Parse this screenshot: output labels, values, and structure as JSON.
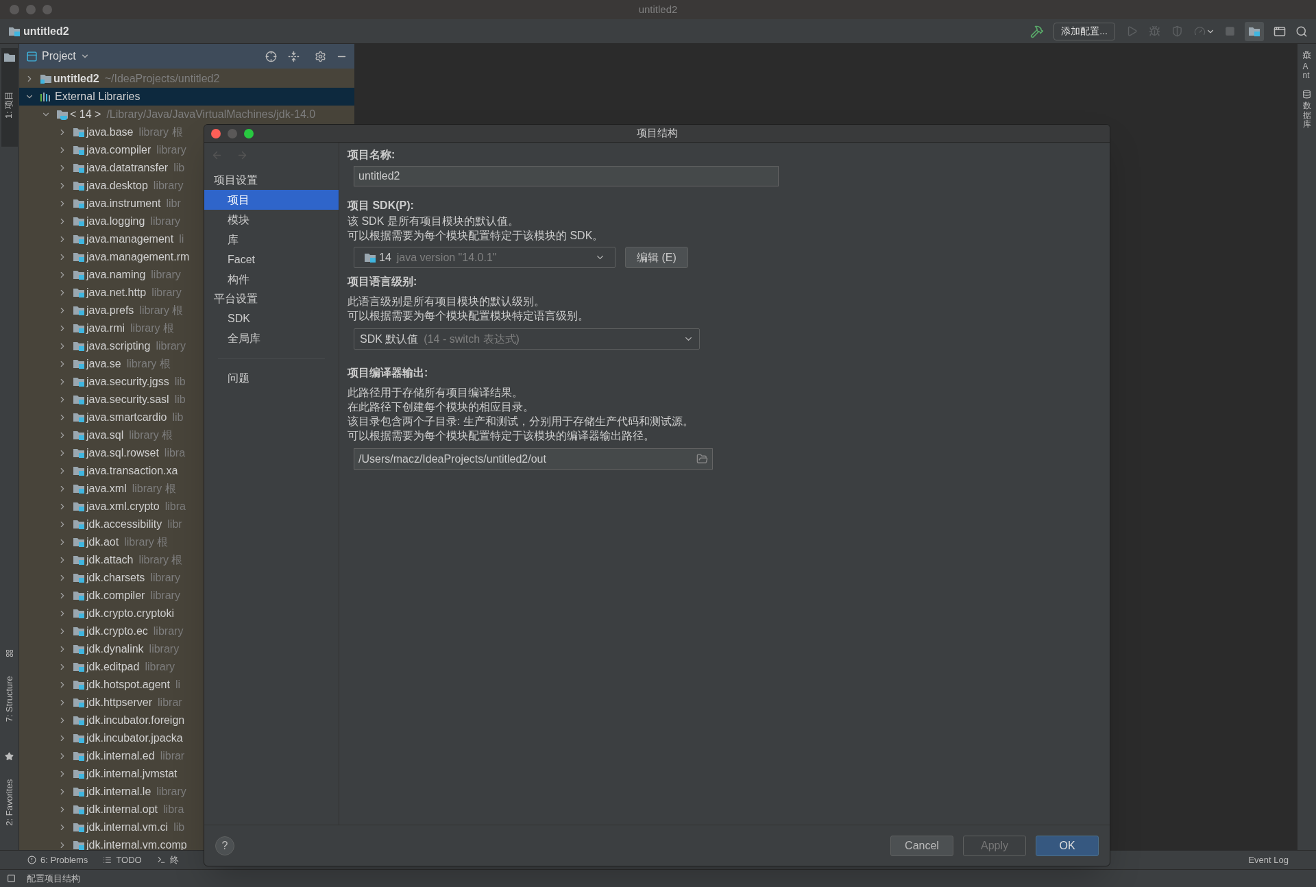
{
  "window": {
    "title": "untitled2"
  },
  "navbar": {
    "project": "untitled2",
    "run_config": "添加配置..."
  },
  "left_strip": [
    {
      "label": "1: 项目",
      "selected": true,
      "kind": "project"
    },
    {
      "label": "7: Structure",
      "selected": false,
      "kind": "structure"
    },
    {
      "label": "2: Favorites",
      "selected": false,
      "kind": "favorites"
    }
  ],
  "right_strip": [
    {
      "label": "Ant",
      "kind": "ant"
    },
    {
      "label": "数据库",
      "kind": "database"
    }
  ],
  "project_panel": {
    "title": "Project",
    "tree": [
      {
        "name": "untitled2",
        "hint": "~/IdeaProjects/untitled2",
        "kind": "module",
        "expanded": false,
        "selected": false
      },
      {
        "name": "External Libraries",
        "kind": "libraries",
        "expanded": true,
        "selected": true,
        "children": [
          {
            "name": "< 14 >",
            "hint": "/Library/Java/JavaVirtualMachines/jdk-14.0",
            "kind": "sdk",
            "expanded": true,
            "selected": false,
            "children": [
              {
                "name": "java.base",
                "hint": "library 根",
                "kind": "package",
                "expanded": false,
                "selected": false
              },
              {
                "name": "java.compiler",
                "hint": "library",
                "kind": "package",
                "expanded": false,
                "selected": false
              },
              {
                "name": "java.datatransfer",
                "hint": "lib",
                "kind": "package",
                "expanded": false,
                "selected": false
              },
              {
                "name": "java.desktop",
                "hint": "library",
                "kind": "package",
                "expanded": false,
                "selected": false
              },
              {
                "name": "java.instrument",
                "hint": "libr",
                "kind": "package",
                "expanded": false,
                "selected": false
              },
              {
                "name": "java.logging",
                "hint": "library",
                "kind": "package",
                "expanded": false,
                "selected": false
              },
              {
                "name": "java.management",
                "hint": "li",
                "kind": "package",
                "expanded": false,
                "selected": false
              },
              {
                "name": "java.management.rm",
                "kind": "package",
                "expanded": false,
                "selected": false
              },
              {
                "name": "java.naming",
                "hint": "library",
                "kind": "package",
                "expanded": false,
                "selected": false
              },
              {
                "name": "java.net.http",
                "hint": "library",
                "kind": "package",
                "expanded": false,
                "selected": false
              },
              {
                "name": "java.prefs",
                "hint": "library 根",
                "kind": "package",
                "expanded": false,
                "selected": false
              },
              {
                "name": "java.rmi",
                "hint": "library 根",
                "kind": "package",
                "expanded": false,
                "selected": false
              },
              {
                "name": "java.scripting",
                "hint": "library",
                "kind": "package",
                "expanded": false,
                "selected": false
              },
              {
                "name": "java.se",
                "hint": "library 根",
                "kind": "package",
                "expanded": false,
                "selected": false
              },
              {
                "name": "java.security.jgss",
                "hint": "lib",
                "kind": "package",
                "expanded": false,
                "selected": false
              },
              {
                "name": "java.security.sasl",
                "hint": "lib",
                "kind": "package",
                "expanded": false,
                "selected": false
              },
              {
                "name": "java.smartcardio",
                "hint": "lib",
                "kind": "package",
                "expanded": false,
                "selected": false
              },
              {
                "name": "java.sql",
                "hint": "library 根",
                "kind": "package",
                "expanded": false,
                "selected": false
              },
              {
                "name": "java.sql.rowset",
                "hint": "libra",
                "kind": "package",
                "expanded": false,
                "selected": false
              },
              {
                "name": "java.transaction.xa",
                "kind": "package",
                "expanded": false,
                "selected": false
              },
              {
                "name": "java.xml",
                "hint": "library 根",
                "kind": "package",
                "expanded": false,
                "selected": false
              },
              {
                "name": "java.xml.crypto",
                "hint": "libra",
                "kind": "package",
                "expanded": false,
                "selected": false
              },
              {
                "name": "jdk.accessibility",
                "hint": "libr",
                "kind": "package",
                "expanded": false,
                "selected": false
              },
              {
                "name": "jdk.aot",
                "hint": "library 根",
                "kind": "package",
                "expanded": false,
                "selected": false
              },
              {
                "name": "jdk.attach",
                "hint": "library 根",
                "kind": "package",
                "expanded": false,
                "selected": false
              },
              {
                "name": "jdk.charsets",
                "hint": "library",
                "kind": "package",
                "expanded": false,
                "selected": false
              },
              {
                "name": "jdk.compiler",
                "hint": "library",
                "kind": "package",
                "expanded": false,
                "selected": false
              },
              {
                "name": "jdk.crypto.cryptoki",
                "kind": "package",
                "expanded": false,
                "selected": false
              },
              {
                "name": "jdk.crypto.ec",
                "hint": "library",
                "kind": "package",
                "expanded": false,
                "selected": false
              },
              {
                "name": "jdk.dynalink",
                "hint": "library",
                "kind": "package",
                "expanded": false,
                "selected": false
              },
              {
                "name": "jdk.editpad",
                "hint": "library",
                "kind": "package",
                "expanded": false,
                "selected": false
              },
              {
                "name": "jdk.hotspot.agent",
                "hint": "li",
                "kind": "package",
                "expanded": false,
                "selected": false
              },
              {
                "name": "jdk.httpserver",
                "hint": "librar",
                "kind": "package",
                "expanded": false,
                "selected": false
              },
              {
                "name": "jdk.incubator.foreign",
                "kind": "package",
                "expanded": false,
                "selected": false
              },
              {
                "name": "jdk.incubator.jpacka",
                "kind": "package",
                "expanded": false,
                "selected": false
              },
              {
                "name": "jdk.internal.ed",
                "hint": "librar",
                "kind": "package",
                "expanded": false,
                "selected": false
              },
              {
                "name": "jdk.internal.jvmstat",
                "kind": "package",
                "expanded": false,
                "selected": false
              },
              {
                "name": "jdk.internal.le",
                "hint": "library",
                "kind": "package",
                "expanded": false,
                "selected": false
              },
              {
                "name": "jdk.internal.opt",
                "hint": "libra",
                "kind": "package",
                "expanded": false,
                "selected": false
              },
              {
                "name": "jdk.internal.vm.ci",
                "hint": "lib",
                "kind": "package",
                "expanded": false,
                "selected": false
              },
              {
                "name": "jdk.internal.vm.comp",
                "kind": "package",
                "expanded": false,
                "selected": false
              }
            ]
          }
        ]
      }
    ]
  },
  "bottom_tools": [
    {
      "label": "6: Problems",
      "kind": "problems"
    },
    {
      "label": "TODO",
      "kind": "todo"
    },
    {
      "label": "终",
      "kind": "terminal"
    }
  ],
  "event_log": "Event Log",
  "status": "配置项目结构",
  "dialog": {
    "title": "项目结构",
    "nav": [
      {
        "label": "项目设置",
        "kind": "header"
      },
      {
        "label": "项目",
        "kind": "item",
        "selected": true
      },
      {
        "label": "模块",
        "kind": "item",
        "selected": false
      },
      {
        "label": "库",
        "kind": "item",
        "selected": false
      },
      {
        "label": "Facet",
        "kind": "item",
        "selected": false
      },
      {
        "label": "构件",
        "kind": "item",
        "selected": false
      },
      {
        "label": "平台设置",
        "kind": "header"
      },
      {
        "label": "SDK",
        "kind": "item",
        "selected": false
      },
      {
        "label": "全局库",
        "kind": "item",
        "selected": false
      },
      {
        "kind": "separator"
      },
      {
        "label": "问题",
        "kind": "item",
        "selected": false
      }
    ],
    "name_label": "项目名称:",
    "name_value": "untitled2",
    "sdk": {
      "label": "项目 SDK(P):",
      "lines": [
        "该 SDK 是所有项目模块的默认值。",
        "可以根据需要为每个模块配置特定于该模块的 SDK。"
      ],
      "value": "14",
      "detail": "java version \"14.0.1\"",
      "edit": "编辑 (E)"
    },
    "language": {
      "label": "项目语言级别:",
      "lines": [
        "此语言级别是所有项目模块的默认级别。",
        "可以根据需要为每个模块配置模块特定语言级别。"
      ],
      "value": "SDK 默认值",
      "detail": "(14 - switch 表达式)"
    },
    "output": {
      "label": "项目编译器输出:",
      "lines": [
        "此路径用于存储所有项目编译结果。",
        "在此路径下创建每个模块的相应目录。",
        "该目录包含两个子目录: 生产和测试，分别用于存储生产代码和测试源。",
        "可以根据需要为每个模块配置特定于该模块的编译器输出路径。"
      ],
      "path": "/Users/macz/IdeaProjects/untitled2/out"
    },
    "help": "?",
    "buttons": [
      {
        "label": "Cancel",
        "kind": "normal"
      },
      {
        "label": "Apply",
        "kind": "disabled"
      },
      {
        "label": "OK",
        "kind": "default"
      }
    ]
  }
}
